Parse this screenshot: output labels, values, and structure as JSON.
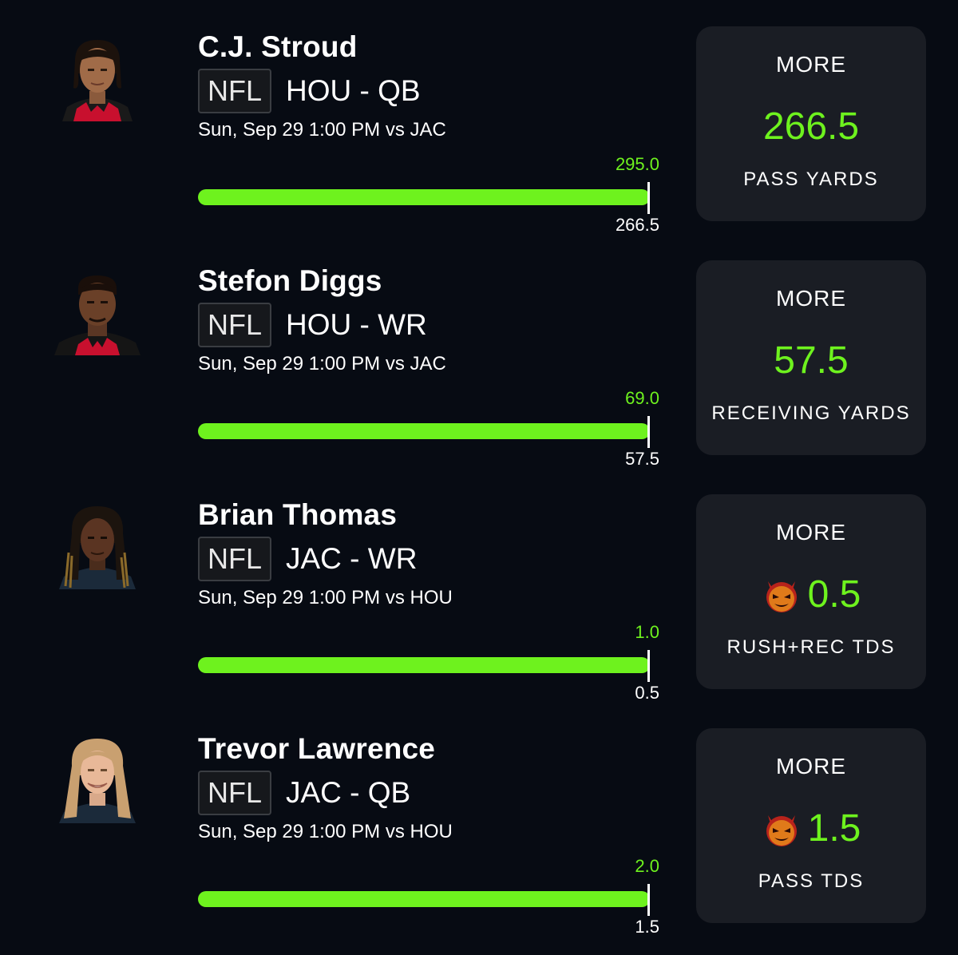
{
  "picks": [
    {
      "player_name": "C.J. Stroud",
      "league": "NFL",
      "team_position": "HOU - QB",
      "game_time": "Sun, Sep 29 1:00 PM  vs JAC",
      "actual_value": "295.0",
      "line_value": "266.5",
      "progress_fraction": 1.0,
      "direction": "MORE",
      "stat_type": "PASS YARDS",
      "demon": false,
      "jersey_color": "#c8102e"
    },
    {
      "player_name": "Stefon Diggs",
      "league": "NFL",
      "team_position": "HOU - WR",
      "game_time": "Sun, Sep 29 1:00 PM  vs JAC",
      "actual_value": "69.0",
      "line_value": "57.5",
      "progress_fraction": 1.0,
      "direction": "MORE",
      "stat_type": "RECEIVING YARDS",
      "demon": false,
      "jersey_color": "#c8102e"
    },
    {
      "player_name": "Brian Thomas",
      "league": "NFL",
      "team_position": "JAC - WR",
      "game_time": "Sun, Sep 29 1:00 PM  vs HOU",
      "actual_value": "1.0",
      "line_value": "0.5",
      "progress_fraction": 1.0,
      "direction": "MORE",
      "stat_type": "RUSH+REC TDS",
      "demon": true,
      "jersey_color": "#1b2a3a"
    },
    {
      "player_name": "Trevor Lawrence",
      "league": "NFL",
      "team_position": "JAC - QB",
      "game_time": "Sun, Sep 29 1:00 PM  vs HOU",
      "actual_value": "2.0",
      "line_value": "1.5",
      "progress_fraction": 1.0,
      "direction": "MORE",
      "stat_type": "PASS TDS",
      "demon": true,
      "jersey_color": "#1b2a3a"
    }
  ],
  "colors": {
    "background": "#070b13",
    "card": "#1a1d24",
    "accent_green": "#6ef21e",
    "text": "#ffffff"
  },
  "icons": {
    "demon": "demon-icon",
    "avatar": "player-headshot"
  }
}
